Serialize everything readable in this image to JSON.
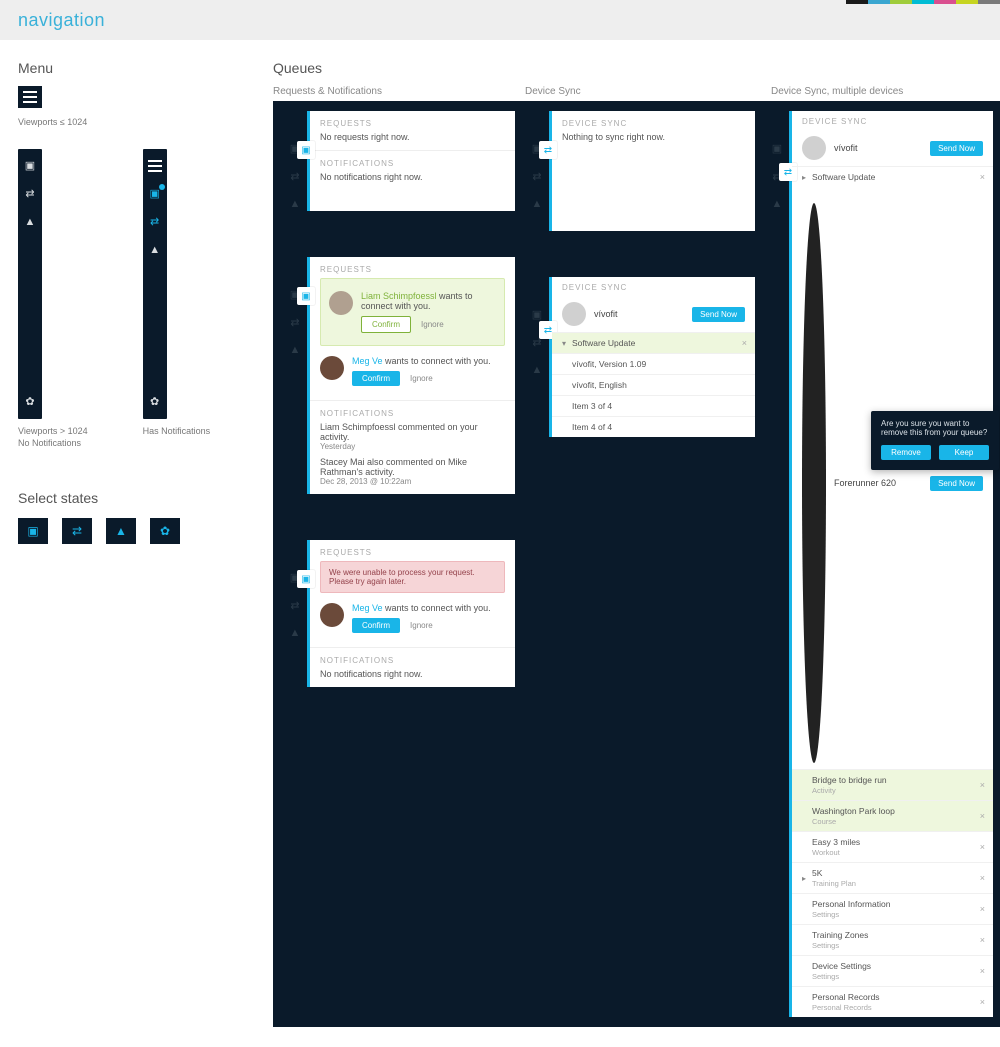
{
  "brand": "navigation",
  "stripe_colors": [
    "#1a1a1a",
    "#3aa6d0",
    "#9fcc3b",
    "#00bcd4",
    "#d94f8f",
    "#c6d420",
    "#7a7a7a"
  ],
  "menu": {
    "title": "Menu",
    "viewport_small": "Viewports ≤ 1024",
    "viewport_large": "Viewports > 1024",
    "no_notifications": "No Notifications",
    "has_notifications": "Has Notifications",
    "select_states": "Select states"
  },
  "queues": {
    "title": "Queues",
    "col1": "Requests & Notifications",
    "col2": "Device Sync",
    "col3": "Device Sync, multiple devices"
  },
  "labels": {
    "requests": "REQUESTS",
    "notifications": "NOTIFICATIONS",
    "device_sync": "DEVICE SYNC",
    "confirm": "Confirm",
    "ignore": "Ignore",
    "send_now": "Send Now",
    "remove": "Remove",
    "keep": "Keep"
  },
  "panel_empty": {
    "no_requests": "No requests right now.",
    "no_notifications": "No notifications right now."
  },
  "panel_requests": {
    "r1_name": "Liam Schimpfoessl",
    "r1_text": " wants to connect with you.",
    "r2_name": "Meg Ve",
    "r2_text": " wants to connect with you.",
    "notif1": "Liam Schimpfoessl commented on your activity.",
    "notif1_time": "Yesterday",
    "notif2": "Stacey Mai also commented on Mike Rathman's activity.",
    "notif2_time": "Dec 28, 2013 @ 10:22am"
  },
  "panel_error": {
    "err": "We were unable to process your request. Please try again later.",
    "r_name": "Meg Ve",
    "r_text": " wants to connect with you."
  },
  "sync_empty": {
    "msg": "Nothing to sync right now."
  },
  "sync_vivofit": {
    "device": "vívofit",
    "rowA": "Software Update",
    "rowB": "vívofit, Version 1.09",
    "rowC": "vívofit, English",
    "rowD": "Item 3 of 4",
    "rowE": "Item 4 of 4"
  },
  "multi": {
    "d1": "vívofit",
    "d1_row": "Software Update",
    "d2": "Forerunner 620",
    "rows": [
      {
        "t": "Bridge to bridge run",
        "s": "Activity",
        "hl": true
      },
      {
        "t": "Washington Park loop",
        "s": "Course",
        "hl": true
      },
      {
        "t": "Easy 3 miles",
        "s": "Workout",
        "hl": false
      },
      {
        "t": "5K",
        "s": "Training Plan",
        "hl": false,
        "caret": true
      },
      {
        "t": "Personal Information",
        "s": "Settings",
        "hl": false
      },
      {
        "t": "Training Zones",
        "s": "Settings",
        "hl": false
      },
      {
        "t": "Device Settings",
        "s": "Settings",
        "hl": false
      },
      {
        "t": "Personal Records",
        "s": "Personal Records",
        "hl": false
      }
    ]
  },
  "popup": {
    "text": "Are you sure you want to remove this from your queue?"
  }
}
